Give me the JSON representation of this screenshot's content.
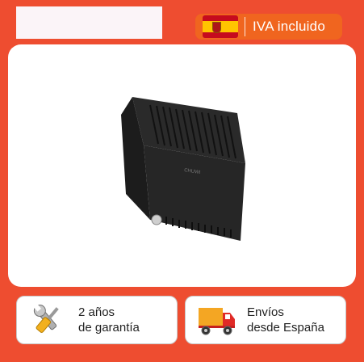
{
  "badge": {
    "flag_icon": "spain-flag-icon",
    "label": "IVA incluido"
  },
  "product": {
    "image_icon": "mini-pc-device-image",
    "brand_text": "CHUWI"
  },
  "features": [
    {
      "icon": "wrench-screwdriver-icon",
      "line1": "2 años",
      "line2": "de garantía"
    },
    {
      "icon": "delivery-truck-icon",
      "line1": "Envíos",
      "line2": "desde España"
    }
  ],
  "colors": {
    "background": "#ee4d30",
    "badge": "#f0651f",
    "panel": "#ffffff",
    "truck_orange": "#f4a623",
    "truck_red": "#e02a26"
  }
}
